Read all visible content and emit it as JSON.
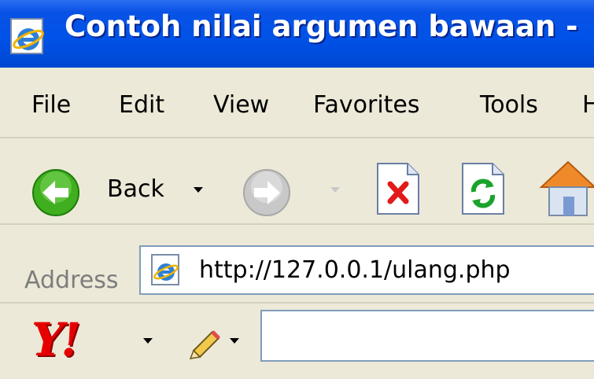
{
  "window": {
    "title": "Contoh nilai argumen bawaan -"
  },
  "menu": {
    "items": [
      "File",
      "Edit",
      "View",
      "Favorites",
      "Tools",
      "Help"
    ]
  },
  "toolbar": {
    "back_label": "Back"
  },
  "address": {
    "label": "Address",
    "url": "http://127.0.0.1/ulang.php"
  },
  "yahoo": {
    "logo_text": "Y!",
    "search_value": ""
  },
  "icons": {
    "title": "ie-icon",
    "back": "back-arrow-icon",
    "forward": "forward-arrow-icon",
    "stop": "stop-icon",
    "refresh": "refresh-icon",
    "home": "home-icon",
    "address_page": "ie-page-icon",
    "yahoo_pencil": "pencil-icon"
  },
  "colors": {
    "titlebar": "#0052e8",
    "chrome": "#ece9d8",
    "yahoo_red": "#e60000",
    "back_green": "#3fae1f"
  }
}
